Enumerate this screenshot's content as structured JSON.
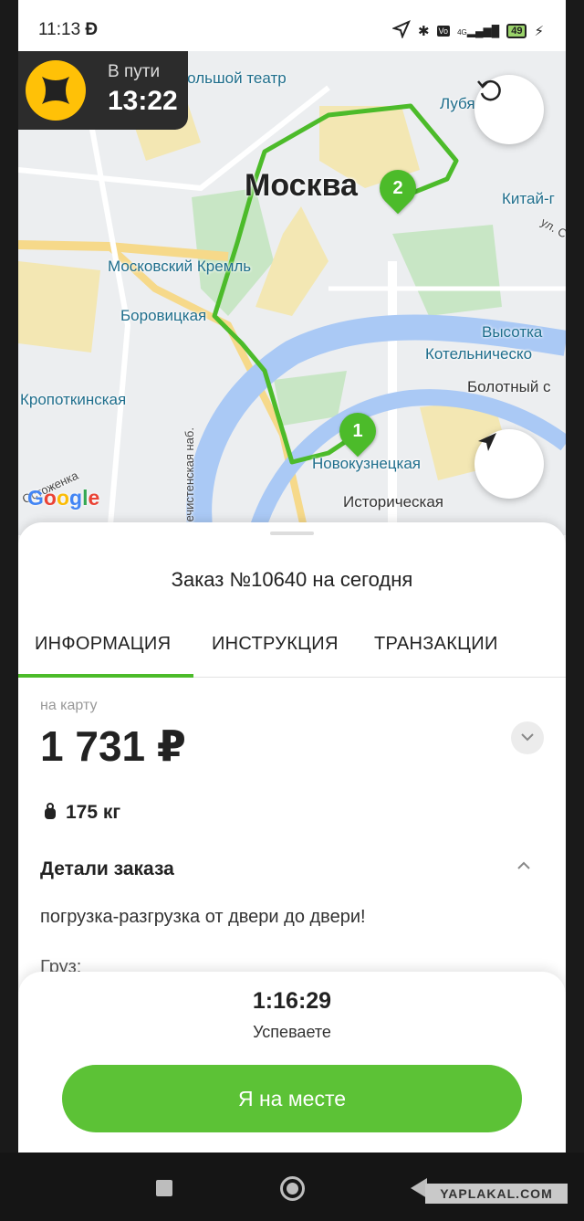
{
  "status_bar": {
    "time": "11:13",
    "carrier_icon": "Ɖ",
    "network": "4G",
    "battery": "49"
  },
  "trip_badge": {
    "status": "В пути",
    "time": "13:22",
    "logo_icon": "yellow-cross-logo"
  },
  "map": {
    "city": "Москва",
    "labels": [
      "Большой театр",
      "Лубя",
      "Китай-г",
      "ул. С",
      "Московский Кремль",
      "Боровицкая",
      "Высотка",
      "Котельническо",
      "Болотный с",
      "Кропоткинская",
      "Новокузнецкая",
      "Историческая",
      "Остоженка",
      "Пречистенская наб."
    ],
    "google": [
      "G",
      "o",
      "o",
      "g",
      "l",
      "e"
    ],
    "pins": [
      "1",
      "2"
    ],
    "route_color": "#4cbb2a"
  },
  "order": {
    "title": "Заказ №10640 на сегодня",
    "tabs": [
      "ИНФОРМАЦИЯ",
      "ИНСТРУКЦИЯ",
      "ТРАНЗАКЦИИ"
    ],
    "active_tab": "ИНФОРМАЦИЯ",
    "payment_label": "на карту",
    "price": "1 731 ₽",
    "weight": "175 кг",
    "details_title": "Детали заказа",
    "details_text": "погрузка-разгрузка от двери до двери!",
    "cargo_label": "Груз:"
  },
  "action": {
    "timer": "1:16:29",
    "timer_status": "Успеваете",
    "button_label": "Я на месте"
  },
  "watermark": "YAPLAKAL.COM",
  "colors": {
    "accent": "#4cbb2a",
    "button": "#5cc236",
    "badge_bg": "#2c2c2c",
    "logo": "#ffc107"
  }
}
